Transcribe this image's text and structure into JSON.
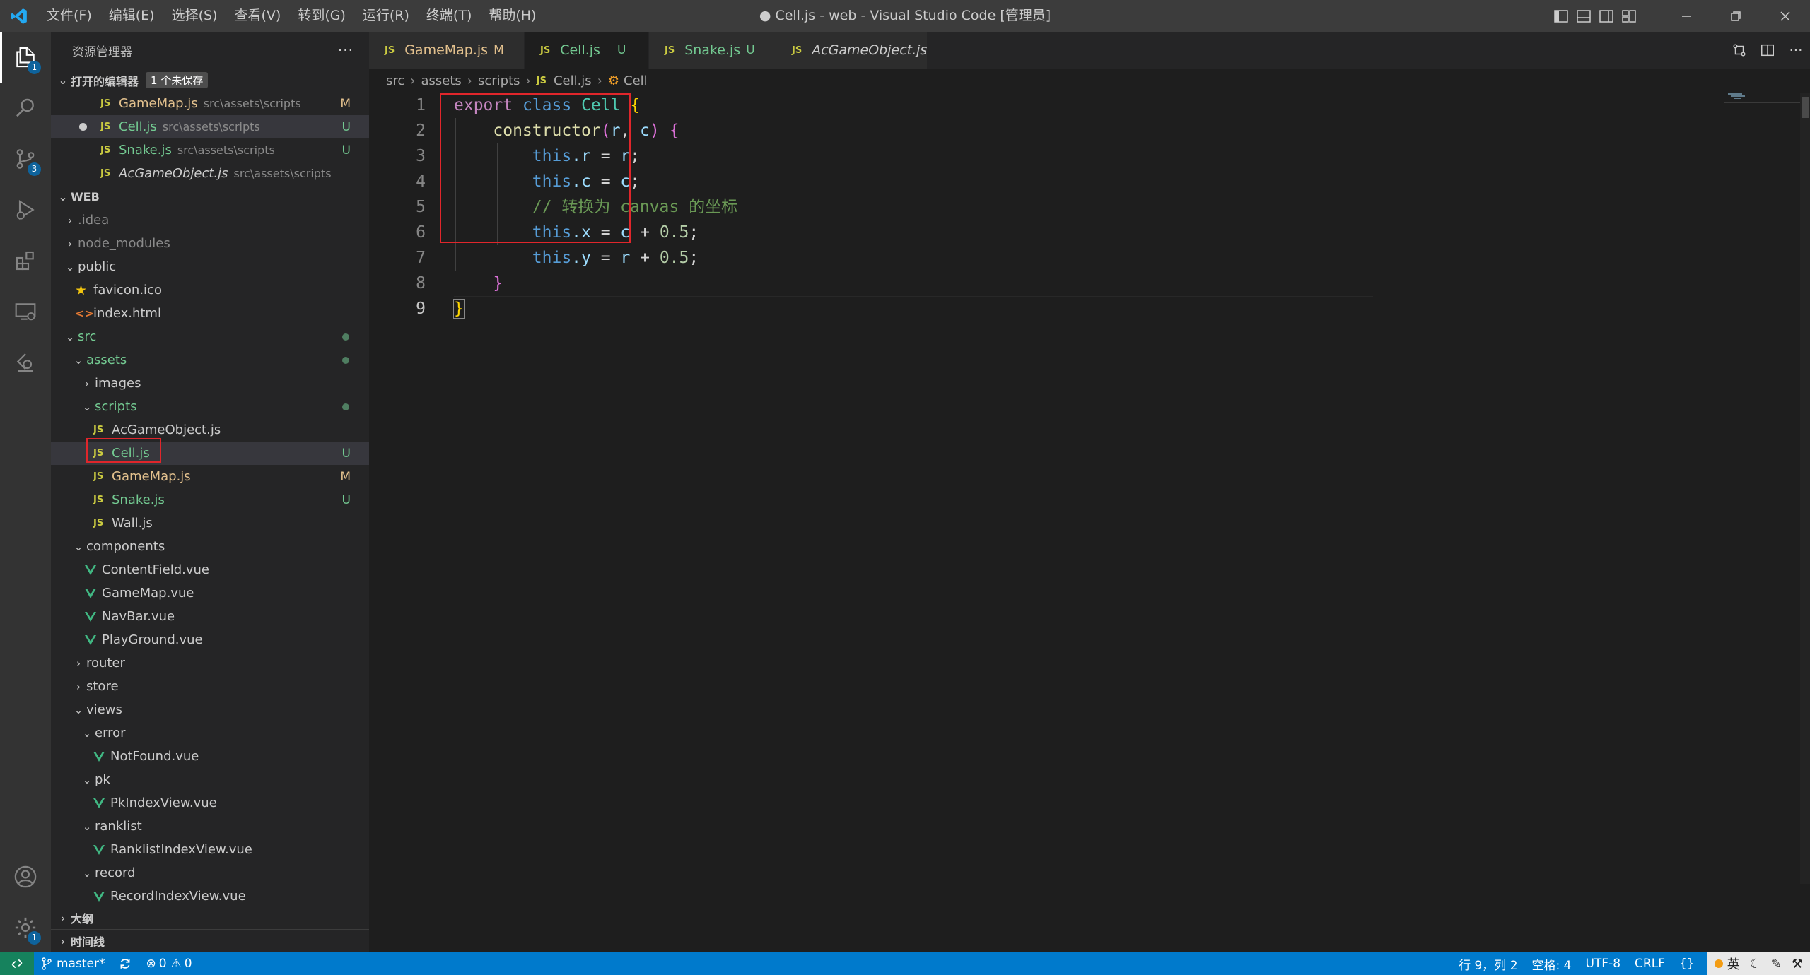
{
  "titlebar": {
    "menu": [
      "文件(F)",
      "编辑(E)",
      "选择(S)",
      "查看(V)",
      "转到(G)",
      "运行(R)",
      "终端(T)",
      "帮助(H)"
    ],
    "window_title": "● Cell.js - web - Visual Studio Code [管理员]"
  },
  "activity": {
    "explorer_badge": "1",
    "scm_badge": "3",
    "settings_badge": "1"
  },
  "sidebar": {
    "title": "资源管理器",
    "open_editors": {
      "label": "打开的编辑器",
      "badge": "1 个未保存",
      "items": [
        {
          "name": "GameMap.js",
          "path": "src\\assets\\scripts",
          "status": "M"
        },
        {
          "name": "Cell.js",
          "path": "src\\assets\\scripts",
          "status": "U"
        },
        {
          "name": "Snake.js",
          "path": "src\\assets\\scripts",
          "status": "U"
        },
        {
          "name": "AcGameObject.js",
          "path": "src\\assets\\scripts",
          "status": ""
        }
      ]
    },
    "workspace": {
      "label": "WEB",
      "tree": [
        {
          "label": ".idea"
        },
        {
          "label": "node_modules"
        },
        {
          "label": "public"
        },
        {
          "label": "favicon.ico"
        },
        {
          "label": "index.html"
        },
        {
          "label": "src"
        },
        {
          "label": "assets"
        },
        {
          "label": "images"
        },
        {
          "label": "scripts"
        },
        {
          "label": "AcGameObject.js"
        },
        {
          "label": "Cell.js",
          "status": "U"
        },
        {
          "label": "GameMap.js",
          "status": "M"
        },
        {
          "label": "Snake.js",
          "status": "U"
        },
        {
          "label": "Wall.js"
        },
        {
          "label": "components"
        },
        {
          "label": "ContentField.vue"
        },
        {
          "label": "GameMap.vue"
        },
        {
          "label": "NavBar.vue"
        },
        {
          "label": "PlayGround.vue"
        },
        {
          "label": "router"
        },
        {
          "label": "store"
        },
        {
          "label": "views"
        },
        {
          "label": "error"
        },
        {
          "label": "NotFound.vue"
        },
        {
          "label": "pk"
        },
        {
          "label": "PkIndexView.vue"
        },
        {
          "label": "ranklist"
        },
        {
          "label": "RanklistIndexView.vue"
        },
        {
          "label": "record"
        },
        {
          "label": "RecordIndexView.vue"
        }
      ]
    },
    "outline_label": "大纲",
    "timeline_label": "时间线"
  },
  "tabs": [
    {
      "name": "GameMap.js",
      "status": "M"
    },
    {
      "name": "Cell.js",
      "status": "U"
    },
    {
      "name": "Snake.js",
      "status": "U"
    },
    {
      "name": "AcGameObject.js",
      "status": ""
    }
  ],
  "breadcrumb": [
    "src",
    "assets",
    "scripts",
    "Cell.js",
    "Cell"
  ],
  "editor": {
    "line_numbers": [
      "1",
      "2",
      "3",
      "4",
      "5",
      "6",
      "7",
      "8",
      "9"
    ],
    "tokens": {
      "export": "export",
      "class": "class",
      "cell": "Cell",
      "constructor": "constructor",
      "r": "r",
      "c": "c",
      "this": "this",
      "prop_r": ".r",
      "prop_c": ".c",
      "prop_x": ".x",
      "prop_y": ".y",
      "num": "0.5",
      "comment": "// 转换为 canvas 的坐标"
    }
  },
  "statusbar": {
    "branch": "master*",
    "errors": "0",
    "warnings": "0",
    "position": "行 9，列 2",
    "spaces": "空格: 4",
    "encoding": "UTF-8",
    "eol": "CRLF",
    "lang": "{}",
    "ime": "英"
  },
  "colors": {
    "statusbar": "#007acc",
    "highlight_box": "#e0262b",
    "js_icon": "#cbcb41",
    "vue_icon": "#41b883"
  }
}
